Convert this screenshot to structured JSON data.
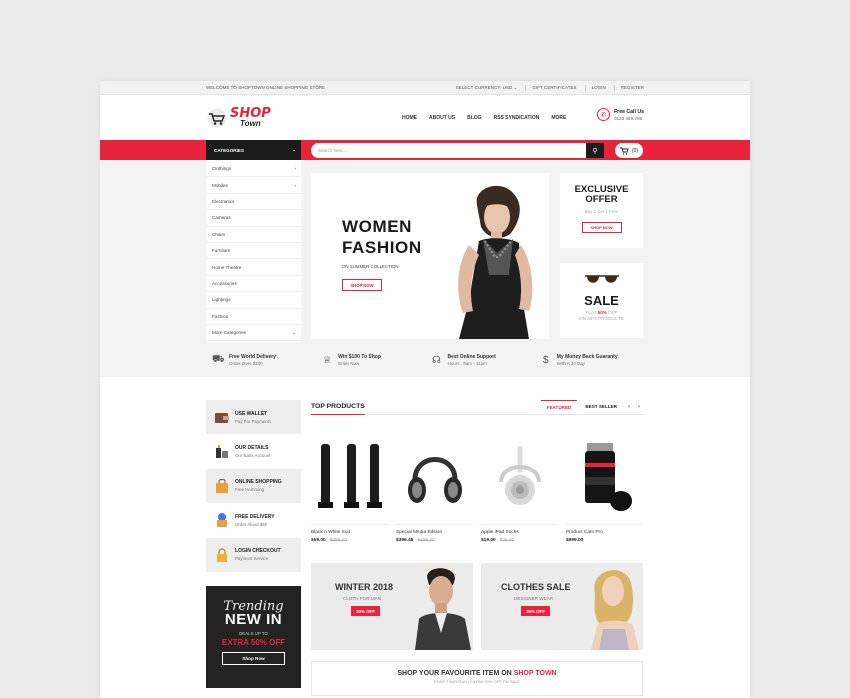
{
  "topbar": {
    "welcome": "Welcome to Shoptown online shopping store",
    "links": [
      "Select Currency: USD ⌄",
      "Gift Certificates",
      "Login",
      "Register"
    ]
  },
  "header": {
    "logo_shop": "SHOP",
    "logo_town": "Town",
    "nav": [
      "Home",
      "About Us",
      "Blog",
      "RSS Syndication",
      "More"
    ],
    "call_title": "Free Call Us",
    "call_number": "0123 456 789"
  },
  "bar": {
    "categories_label": "Categories",
    "search_placeholder": "Search here.....",
    "cart_count": "(0)"
  },
  "categories": [
    {
      "label": "Clothings",
      "arrow": "›"
    },
    {
      "label": "Mobiles",
      "arrow": "›"
    },
    {
      "label": "Electronics",
      "arrow": ""
    },
    {
      "label": "Cameras",
      "arrow": ""
    },
    {
      "label": "Chairs",
      "arrow": ""
    },
    {
      "label": "Furniture",
      "arrow": ""
    },
    {
      "label": "Home Theatre",
      "arrow": ""
    },
    {
      "label": "Accessories",
      "arrow": ""
    },
    {
      "label": "Lightings",
      "arrow": ""
    },
    {
      "label": "Fashion",
      "arrow": ""
    },
    {
      "label": "More Categories",
      "arrow": "⌄"
    }
  ],
  "hero": {
    "line1": "WOMEN",
    "line2": "FASHION",
    "sub": "On Summer Collection",
    "button": "SHOP NOW"
  },
  "promo_offer": {
    "line1": "EXCLUSIVE",
    "line2": "OFFER",
    "sub": "Buy 1 Get 1 Free",
    "button": "SHOP NOW"
  },
  "promo_sale": {
    "title": "SALE",
    "sub_pre": "Flat ",
    "sub_pct": "50%",
    "sub_post": " Off",
    "sub2": "On MP3 Products"
  },
  "features": [
    {
      "title": "Free World Delivery",
      "sub": "Order Over $100",
      "icon": "▭"
    },
    {
      "title": "Win $100 To Shop",
      "sub": "Enter Now",
      "icon": "♙"
    },
    {
      "title": "Best Online Support",
      "sub": "Hours : 8am - 11pm",
      "icon": "☊"
    },
    {
      "title": "My Money Back Guaranty",
      "sub": "With A 30 Day",
      "icon": "$"
    }
  ],
  "services": [
    {
      "title": "Use Wallet",
      "sub": "Pay For Payments"
    },
    {
      "title": "Our Details",
      "sub": "Our Bank Account"
    },
    {
      "title": "Online Shopping",
      "sub": "Free Hemming"
    },
    {
      "title": "Free Delivery",
      "sub": "Order About $50"
    },
    {
      "title": "Login Checkout",
      "sub": "Payment Service"
    }
  ],
  "trending": {
    "line1": "Trending",
    "line2": "NEW IN",
    "deals": "Deals up to",
    "extra": "EXTRA 50% OFF",
    "button": "Shop Now"
  },
  "top_products": {
    "title": "Top Products",
    "tabs": [
      "Featured",
      "Best Seller"
    ],
    "prev": "‹",
    "next": "›",
    "items": [
      {
        "name": "Black n White Suit",
        "price": "$59.00",
        "old": "$999.00"
      },
      {
        "name": "Special Media Edition",
        "price": "$399.45",
        "old": "$499.00"
      },
      {
        "name": "Apple iPad Socks",
        "price": "$19.00",
        "old": "$25.00"
      },
      {
        "name": "Product Cam Pro",
        "price": "$899.00",
        "old": ""
      }
    ]
  },
  "banner_winter": {
    "title": "WINTER 2018",
    "sub": "Cloth For Man",
    "badge": "20% OFF"
  },
  "banner_clothes": {
    "title": "CLOTHES SALE",
    "sub": "Designer Wear",
    "badge": "35% OFF"
  },
  "shop_fav": {
    "pre": "Shop Your Favourite Item On ",
    "brand": "Shop Town",
    "sub": "Ends Thursday! Extra 30% Off On Sale"
  },
  "colors": {
    "accent": "#e8243c",
    "dark": "#1b1b1b"
  }
}
